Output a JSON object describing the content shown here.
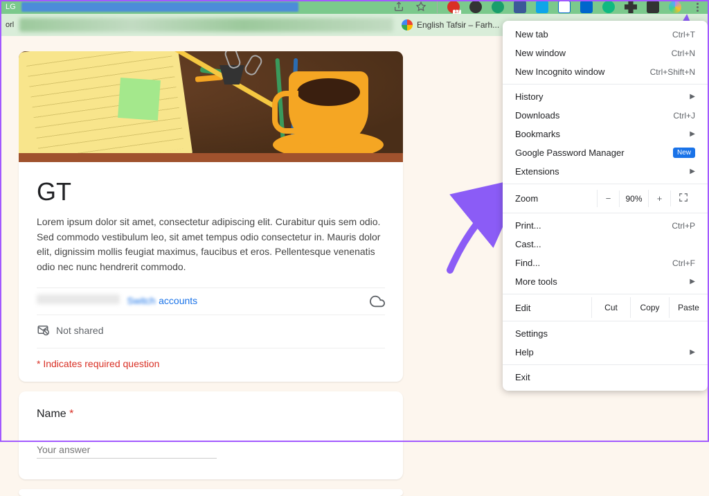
{
  "browser": {
    "bookmark_tab_label": "English Tafsir – Farh..."
  },
  "form": {
    "title": "GT",
    "description": "Lorem ipsum dolor sit amet, consectetur adipiscing elit. Curabitur quis sem odio. Sed commodo vestibulum leo, sit amet tempus odio consectetur in. Mauris dolor elit, dignissim mollis feugiat maximus, faucibus et eros. Pellentesque venenatis odio nec nunc hendrerit commodo.",
    "switch_accounts": "accounts",
    "not_shared": "Not shared",
    "required_note": "* Indicates required question",
    "question1": {
      "label": "Name",
      "required": "*",
      "placeholder": "Your answer"
    }
  },
  "menu": {
    "new_tab": {
      "label": "New tab",
      "shortcut": "Ctrl+T"
    },
    "new_window": {
      "label": "New window",
      "shortcut": "Ctrl+N"
    },
    "incognito": {
      "label": "New Incognito window",
      "shortcut": "Ctrl+Shift+N"
    },
    "history": {
      "label": "History"
    },
    "downloads": {
      "label": "Downloads",
      "shortcut": "Ctrl+J"
    },
    "bookmarks": {
      "label": "Bookmarks"
    },
    "password_mgr": {
      "label": "Google Password Manager",
      "badge": "New"
    },
    "extensions": {
      "label": "Extensions"
    },
    "zoom": {
      "label": "Zoom",
      "minus": "−",
      "value": "90%",
      "plus": "+"
    },
    "print": {
      "label": "Print...",
      "shortcut": "Ctrl+P"
    },
    "cast": {
      "label": "Cast..."
    },
    "find": {
      "label": "Find...",
      "shortcut": "Ctrl+F"
    },
    "more_tools": {
      "label": "More tools"
    },
    "edit": {
      "label": "Edit",
      "cut": "Cut",
      "copy": "Copy",
      "paste": "Paste"
    },
    "settings": {
      "label": "Settings"
    },
    "help": {
      "label": "Help"
    },
    "exit": {
      "label": "Exit"
    }
  }
}
